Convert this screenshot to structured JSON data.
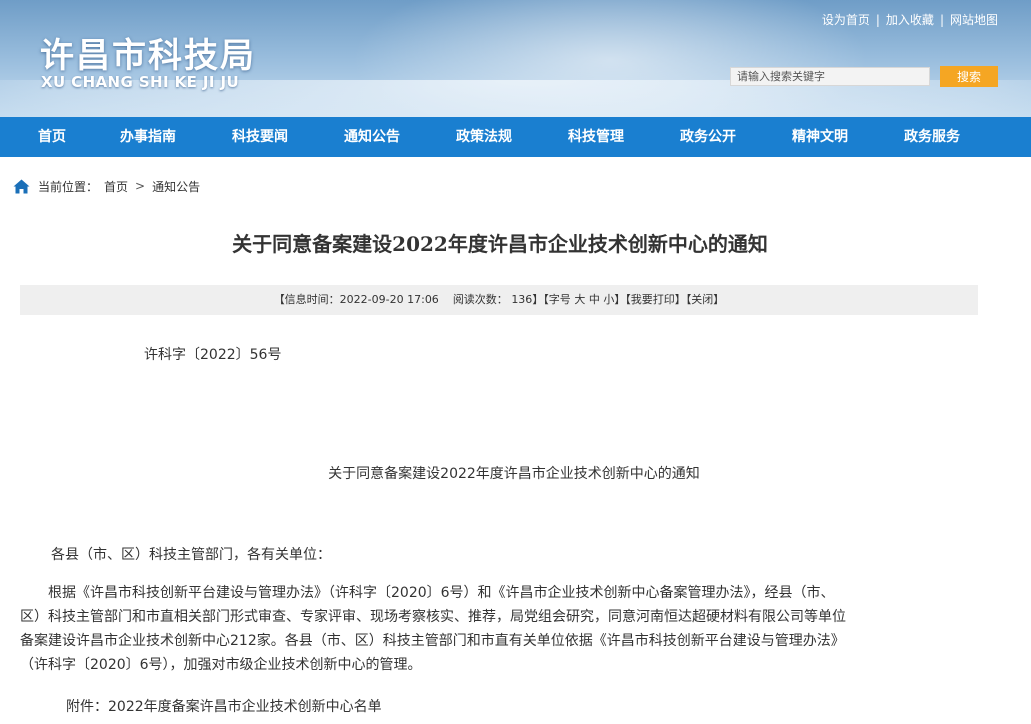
{
  "header": {
    "logo_cn": "许昌市科技局",
    "logo_en": "XU CHANG SHI KE JI JU",
    "links": [
      "设为首页",
      "加入收藏",
      "网站地图"
    ],
    "link_separator": "|",
    "search_placeholder": "请输入搜索关键字",
    "search_button": "搜索"
  },
  "nav": {
    "items": [
      "首页",
      "办事指南",
      "科技要闻",
      "通知公告",
      "政策法规",
      "科技管理",
      "政务公开",
      "精神文明",
      "政务服务"
    ]
  },
  "breadcrumb": {
    "label": "当前位置：",
    "home": "首页",
    "separator": ">",
    "current": "通知公告"
  },
  "article": {
    "title": "关于同意备案建设2022年度许昌市企业技术创新中心的通知",
    "info": {
      "time": "【信息时间：2022-09-20 17:06",
      "reads": "阅读次数：",
      "reads_count": "136",
      "font_label": "】【字号",
      "font_large": "大",
      "font_medium": "中",
      "font_small": "小",
      "print": "】【我要打印】",
      "close": "【关闭】"
    },
    "doc_number": "许科字〔2022〕56号",
    "doc_title": "关于同意备案建设2022年度许昌市企业技术创新中心的通知",
    "salutation": "各县（市、区）科技主管部门，各有关单位：",
    "body_lines": [
      "　　根据《许昌市科技创新平台建设与管理办法》（许科字〔2020〕6号）和《许昌市企业技术创新中心备案管理办法》，经县（市、",
      "区）科技主管部门和市直相关部门形式审查、专家评审、现场考察核实、推荐，局党组会研究，同意河南恒达超硬材料有限公司等单位",
      "备案建设许昌市企业技术创新中心212家。各县（市、区）科技主管部门和市直有关单位依据《许昌市科技创新平台建设与管理办法》",
      "（许科字〔2020〕6号），加强对市级企业技术创新中心的管理。"
    ],
    "attachment": "附件：2022年度备案许昌市企业技术创新中心名单"
  },
  "colors": {
    "nav_bg": "#1a7fd0",
    "search_button_bg": "#f5a623",
    "home_icon": "#1a6fb8",
    "info_bar_bg": "#efefef"
  },
  "icons": {
    "home": "home-icon"
  }
}
